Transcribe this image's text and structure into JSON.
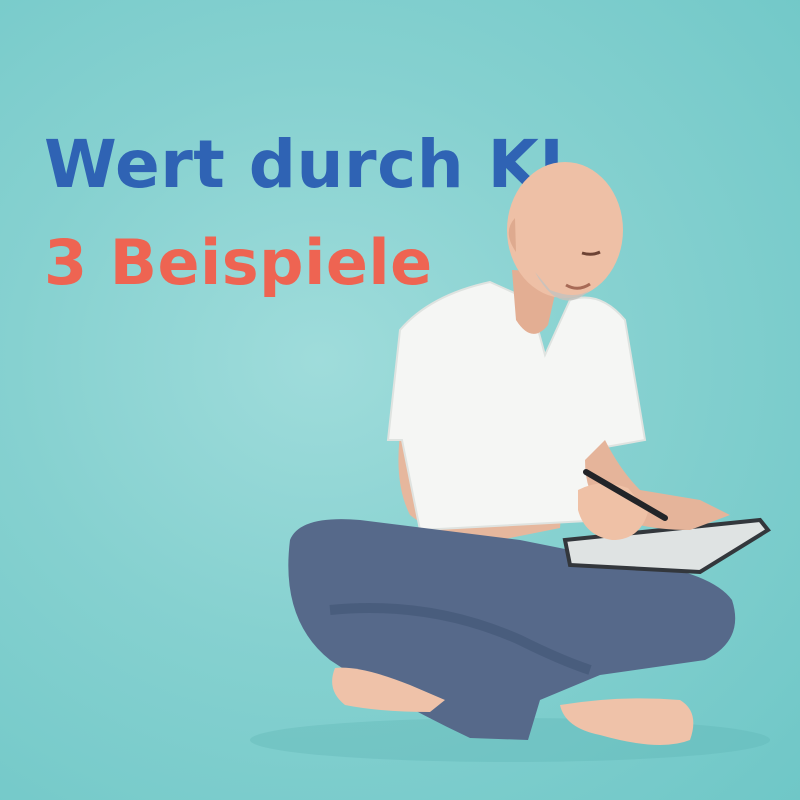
{
  "headline": {
    "line1": "Wert durch KI",
    "line2": "3 Beispiele"
  },
  "colors": {
    "background": "#86d1d0",
    "line1": "#2f63b4",
    "line2": "#ee6452"
  },
  "photo": {
    "subject_icon": "seated-man-writing-on-tablet"
  }
}
